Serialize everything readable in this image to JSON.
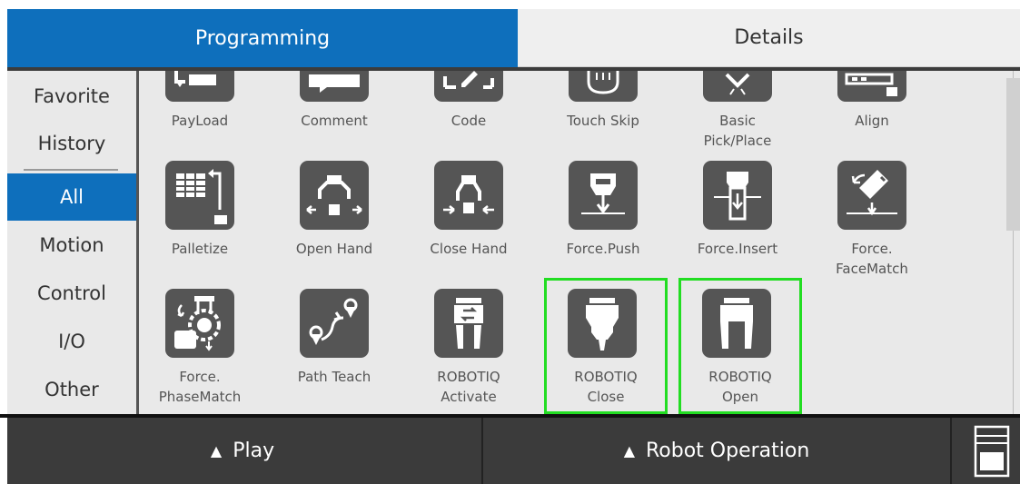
{
  "tabs": {
    "programming": "Programming",
    "details": "Details"
  },
  "sidebar": {
    "items": [
      {
        "label": "Favorite",
        "icon": "",
        "active": false
      },
      {
        "label": "History",
        "icon": "",
        "active": false
      },
      {
        "label": "All",
        "icon": "",
        "active": true
      },
      {
        "label": "Motion",
        "icon": "",
        "active": false
      },
      {
        "label": "Control",
        "icon": "",
        "active": false
      },
      {
        "label": "I/O",
        "icon": "",
        "active": false
      },
      {
        "label": "Other",
        "icon": "",
        "active": false
      }
    ]
  },
  "palette": {
    "row1": [
      {
        "label": "PayLoad",
        "icon": "payload-icon"
      },
      {
        "label": "Comment",
        "icon": "comment-icon"
      },
      {
        "label": "Code",
        "icon": "code-icon"
      },
      {
        "label": "Touch Skip",
        "icon": "touch-skip-icon"
      },
      {
        "label": "Basic Pick/Place",
        "icon": "pick-place-icon"
      },
      {
        "label": "Align",
        "icon": "align-icon"
      }
    ],
    "row2": [
      {
        "label": "Palletize",
        "icon": "palletize-icon"
      },
      {
        "label": "Open Hand",
        "icon": "open-hand-icon"
      },
      {
        "label": "Close Hand",
        "icon": "close-hand-icon"
      },
      {
        "label": "Force.Push",
        "icon": "force-push-icon"
      },
      {
        "label": "Force.Insert",
        "icon": "force-insert-icon"
      },
      {
        "label": "Force.FaceMatch",
        "icon": "force-facematch-icon"
      }
    ],
    "row3": [
      {
        "label": "Force.PhaseMatch",
        "icon": "force-phasematch-icon"
      },
      {
        "label": "Path Teach",
        "icon": "path-teach-icon"
      },
      {
        "label": "ROBOTIQ Activate",
        "icon": "robotiq-activate-icon"
      },
      {
        "label": "ROBOTIQ Close",
        "icon": "robotiq-close-icon",
        "selected": true
      },
      {
        "label": "ROBOTIQ Open",
        "icon": "robotiq-open-icon",
        "selected": true
      }
    ],
    "row1_labels_display": [
      "PayLoad",
      "Comment",
      "Code",
      "Touch Skip",
      "Basic\nPick/Place",
      "Align"
    ],
    "row2_labels_display": [
      "Palletize",
      "Open Hand",
      "Close Hand",
      "Force.Push",
      "Force.Insert",
      "Force.\nFaceMatch"
    ],
    "row3_labels_display": [
      "Force.\nPhaseMatch",
      "Path Teach",
      "ROBOTIQ\nActivate",
      "ROBOTIQ\nClose",
      "ROBOTIQ\nOpen"
    ]
  },
  "bottom": {
    "play": "Play",
    "robot_operation": "Robot Operation",
    "panel_icon": "teach-pendant-icon"
  },
  "colors": {
    "accent": "#0e6fbc",
    "tile": "#555555",
    "selection": "#22dd22"
  }
}
